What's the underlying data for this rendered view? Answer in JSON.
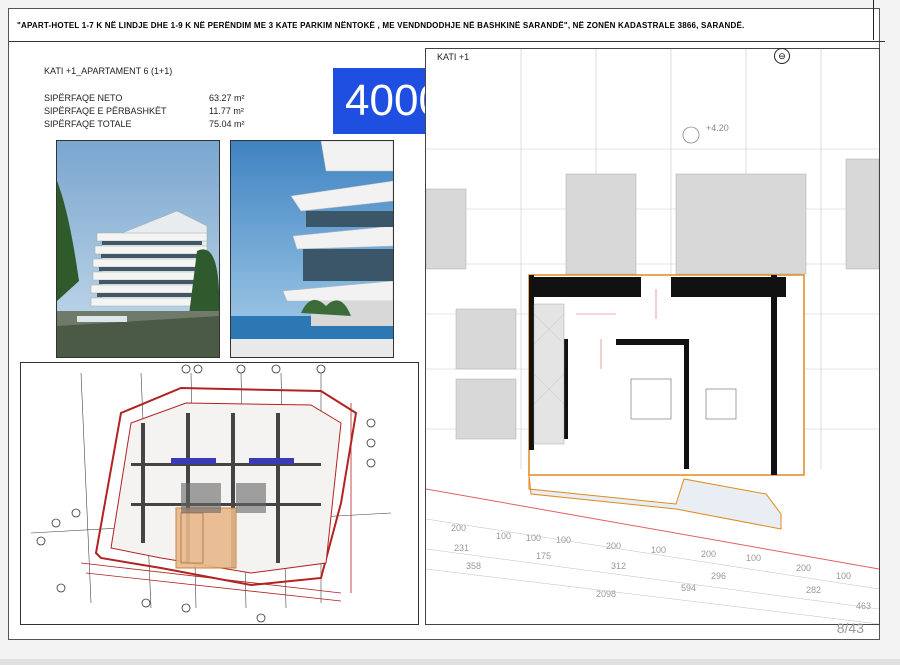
{
  "header": {
    "title": "\"APART-HOTEL 1-7 K NË LINDJE DHE 1-9 K NË PERËNDIM ME 3 KATE PARKIM NËNTOKË , ME VENDNDODHJE NË BASHKINË SARANDË\", NË ZONËN KADASTRALE 3866, SARANDË."
  },
  "apartment": {
    "title": "KATI +1_APARTAMENT 6   (1+1)",
    "areas": [
      {
        "label": "SIPËRFAQE NETO",
        "value": "63.27 m²"
      },
      {
        "label": "SIPËRFAQE E PËRBASHKËT",
        "value": "11.77 m²"
      },
      {
        "label": "SIPËRFAQE TOTALE",
        "value": "75.04 m²"
      }
    ]
  },
  "price": "4000",
  "floor_plan": {
    "label": "KATI +1",
    "elevation": "+4.20"
  },
  "page_indicator": "8/43",
  "colors": {
    "price_bg": "#1f4fe0",
    "apartment_outline": "#e08a1e",
    "structure": "#b22222"
  }
}
